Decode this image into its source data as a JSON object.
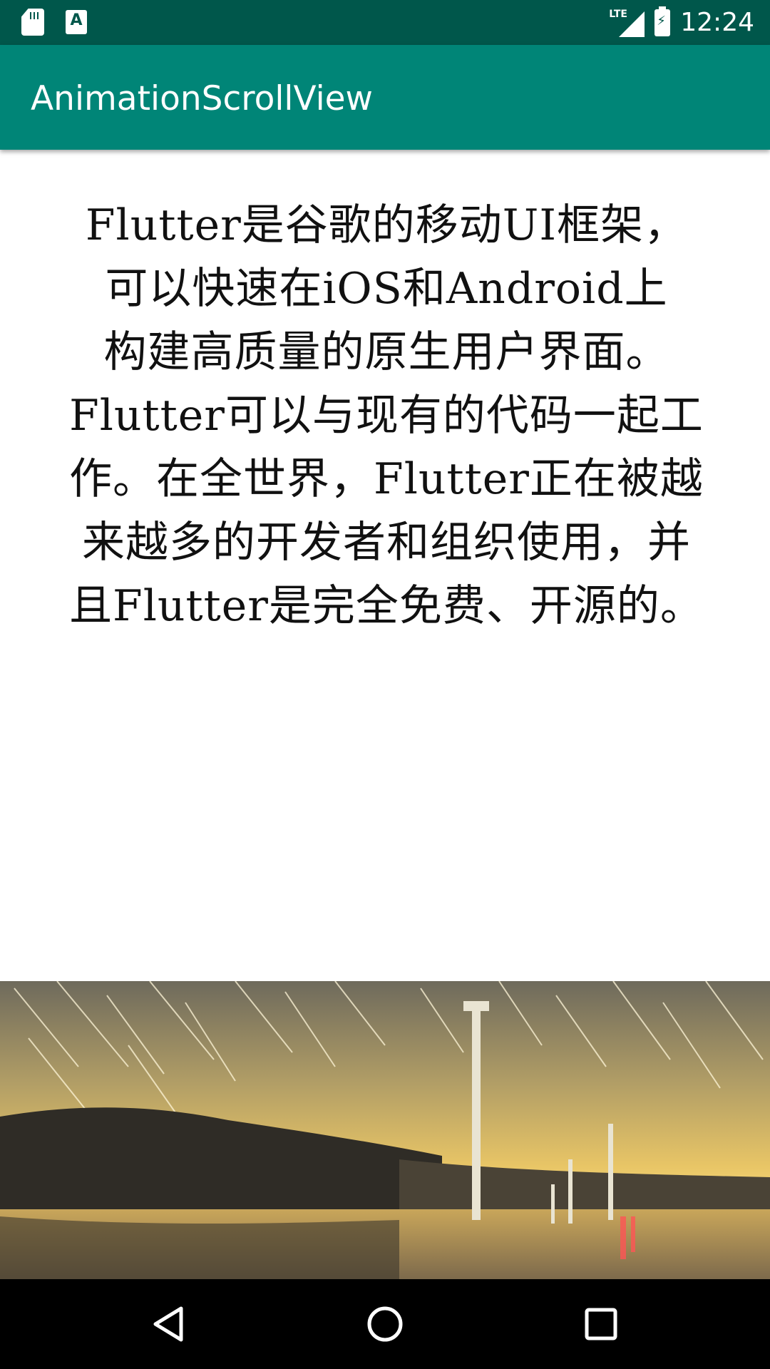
{
  "status_bar": {
    "time": "12:24",
    "network": "LTE",
    "icons": [
      "sd-card-icon",
      "accessibility-a-icon",
      "lte-signal-icon",
      "battery-charging-icon"
    ]
  },
  "app_bar": {
    "title": "AnimationScrollView",
    "color": "#008577",
    "status_color": "#00574b"
  },
  "content": {
    "lines": [
      "Flutter是谷歌的移动UI框架，",
      "可以快速在iOS和Android上",
      "构建高质量的原生用户界面。",
      "Flutter可以与现有的代码一起工",
      "作。在全世界，Flutter正在被越",
      "来越多的开发者和组织使用，并",
      "且Flutter是完全免费、开源的。"
    ]
  },
  "image": {
    "icon": "star-trail-windmill-photo"
  },
  "nav_bar": {
    "buttons": [
      "back-icon",
      "home-icon",
      "recents-icon"
    ]
  }
}
